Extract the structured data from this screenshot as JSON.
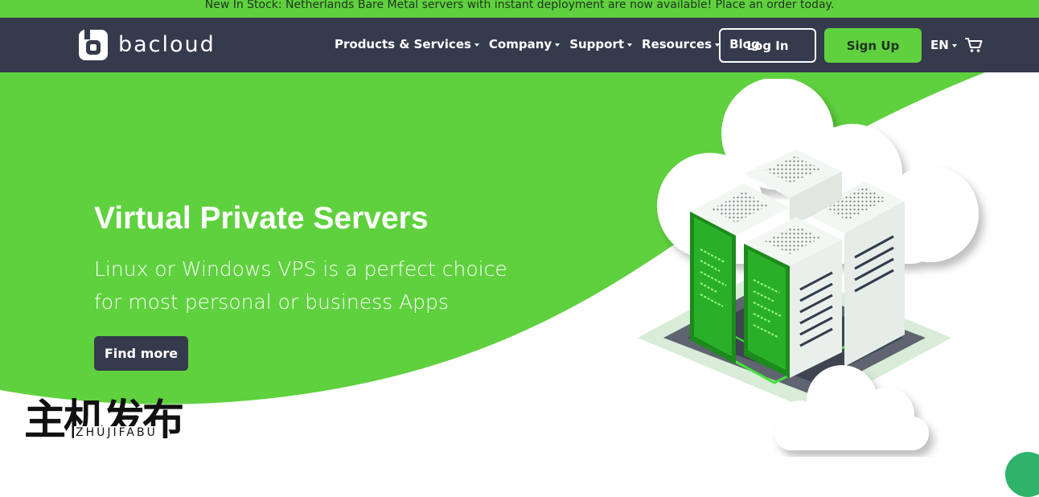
{
  "announcement": "New In Stock: Netherlands Bare Metal servers with instant deployment are now available! Place an order today.",
  "brand": {
    "name": "bacloud"
  },
  "nav": {
    "items": [
      {
        "label": "Products & Services",
        "dropdown": true
      },
      {
        "label": "Company",
        "dropdown": true
      },
      {
        "label": "Support",
        "dropdown": true
      },
      {
        "label": "Resources",
        "dropdown": true
      },
      {
        "label": "Blog",
        "dropdown": false
      }
    ],
    "login": "Log In",
    "signup": "Sign Up",
    "language": "EN",
    "cart_icon": "cart-icon"
  },
  "hero": {
    "title": "Virtual Private Servers",
    "subtitle_line1": "Linux or Windows VPS is a perfect choice",
    "subtitle_line2": "for most personal or business Apps",
    "button": "Find more",
    "illustration": "server-cloud-illustration"
  },
  "watermark": {
    "cn": "主机发布",
    "en": "ZHUJIFABU"
  },
  "colors": {
    "accent": "#5fd13e",
    "nav_bg": "#353a4d",
    "text_light": "#ffffff"
  }
}
